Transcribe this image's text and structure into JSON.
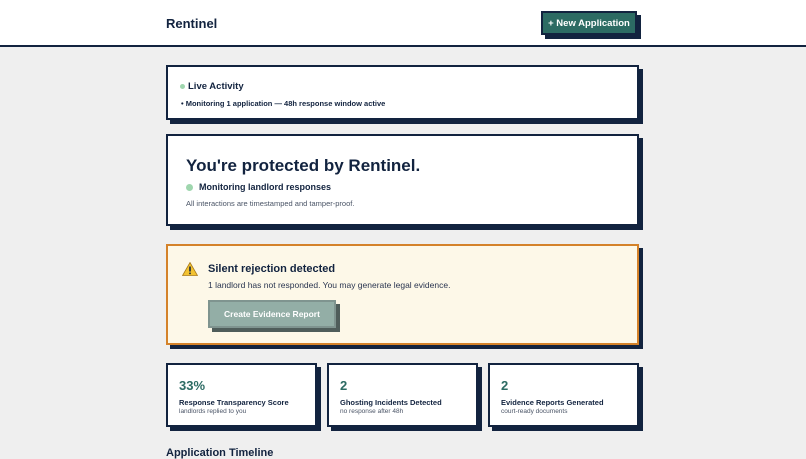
{
  "header": {
    "brand": "Rentinel",
    "new_application_label": "+ New Application"
  },
  "live_activity": {
    "title": "Live Activity",
    "message": "• Monitoring 1 application — 48h response window active"
  },
  "protection": {
    "title": "You're protected by Rentinel.",
    "status": "Monitoring landlord responses",
    "note": "All interactions are timestamped and tamper-proof."
  },
  "alert": {
    "title": "Silent rejection detected",
    "message": "1 landlord has not responded. You may generate legal evidence.",
    "button_label": "Create Evidence Report"
  },
  "stats": [
    {
      "value": "33%",
      "label": "Response Transparency Score",
      "sub": "landlords replied to you"
    },
    {
      "value": "2",
      "label": "Ghosting Incidents Detected",
      "sub": "no response after 48h"
    },
    {
      "value": "2",
      "label": "Evidence Reports Generated",
      "sub": "court-ready documents"
    }
  ],
  "timeline": {
    "title": "Application Timeline"
  },
  "colors": {
    "accent": "#2c6b63",
    "navy": "#12233f",
    "warning_border": "#d4822a",
    "status_dot": "#9fd6ae"
  },
  "icons": {
    "warning": "warning-icon",
    "live_status": "status-dot-icon"
  }
}
